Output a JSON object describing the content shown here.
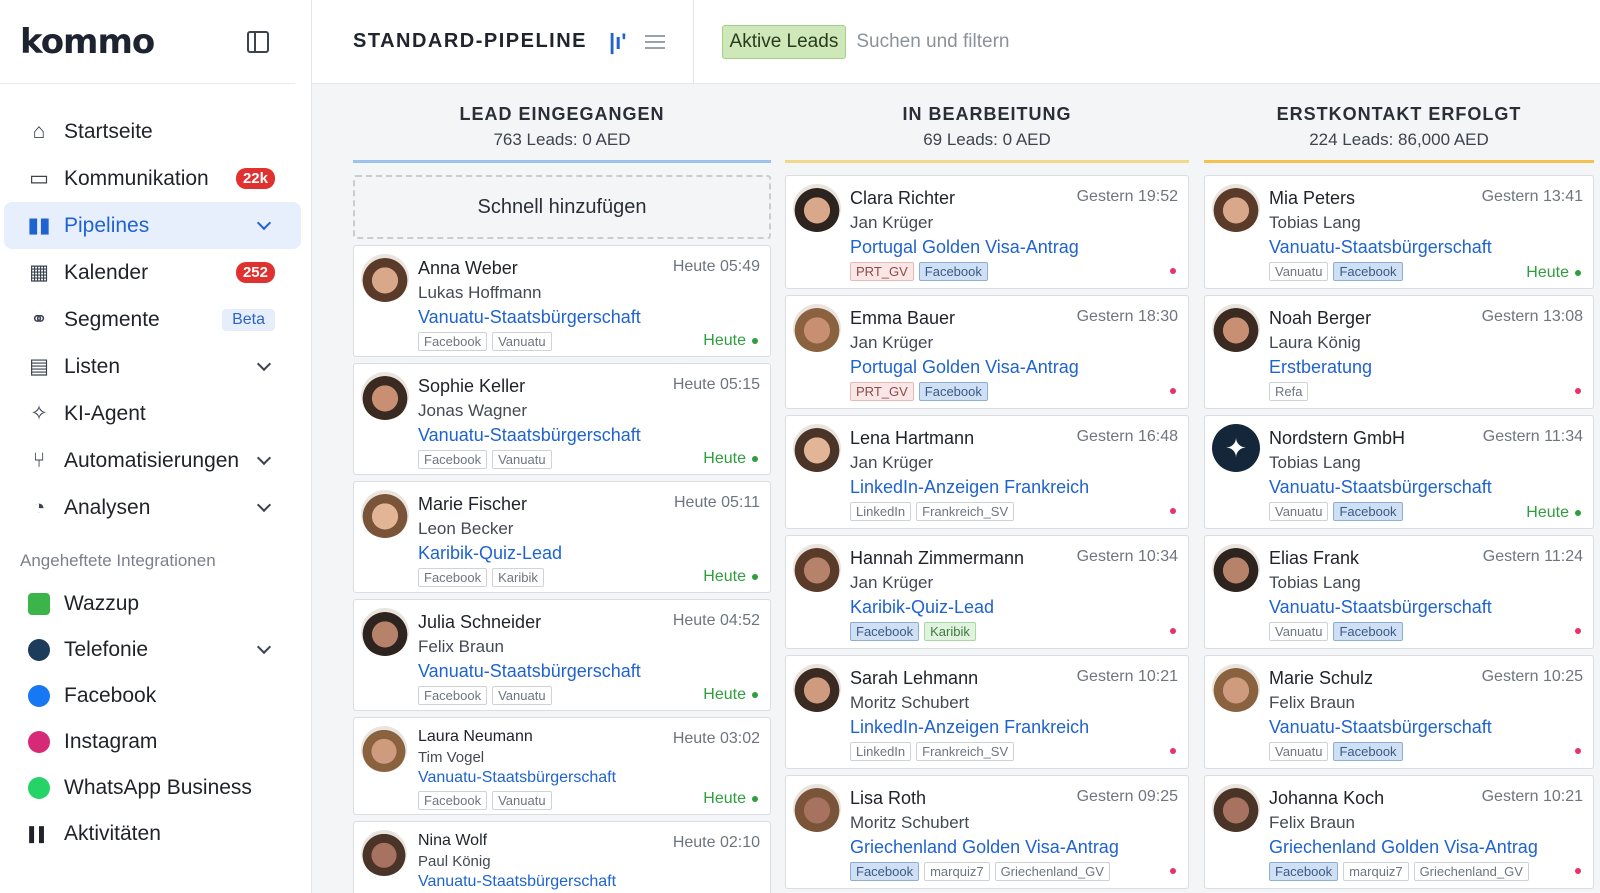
{
  "brand": {
    "logo": "kommo"
  },
  "sidebar": {
    "items": [
      {
        "label": "Startseite",
        "icon": "home-icon"
      },
      {
        "label": "Kommunikation",
        "icon": "chat-icon",
        "badge": "22k"
      },
      {
        "label": "Pipelines",
        "icon": "pipeline-icon",
        "active": true
      },
      {
        "label": "Kalender",
        "icon": "calendar-icon",
        "badge": "252"
      },
      {
        "label": "Segmente",
        "icon": "segments-icon",
        "tag": "Beta"
      },
      {
        "label": "Listen",
        "icon": "list-icon"
      },
      {
        "label": "KI-Agent",
        "icon": "sparkle-icon"
      },
      {
        "label": "Automatisierungen",
        "icon": "automation-icon"
      },
      {
        "label": "Analysen",
        "icon": "analytics-icon"
      }
    ],
    "section_title": "Angeheftete Integrationen",
    "integrations": [
      {
        "label": "Wazzup",
        "icon": "wazzup-icon",
        "color": "#3bb54a"
      },
      {
        "label": "Telefonie",
        "icon": "telephony-icon",
        "color": "#1d3b5a"
      },
      {
        "label": "Facebook",
        "icon": "facebook-icon",
        "color": "#1877f2"
      },
      {
        "label": "Instagram",
        "icon": "instagram-icon",
        "color": "#d62976"
      },
      {
        "label": "WhatsApp Business",
        "icon": "whatsapp-icon",
        "color": "#25d366"
      },
      {
        "label": "Aktivitäten",
        "icon": "activity-icon",
        "color": "#1f2329"
      }
    ]
  },
  "topbar": {
    "pipeline_title": "STANDARD-PIPELINE",
    "filter_label": "Aktive Leads",
    "search_placeholder": "Suchen und filtern"
  },
  "columns": [
    {
      "title": "LEAD EINGEGANGEN",
      "subtitle": "763 Leads: 0 AED",
      "line_color": "#9ec3ea",
      "quick_add": "Schnell hinzufügen",
      "cards": [
        {
          "name": "Anna Weber",
          "time": "Heute 05:49",
          "contact": "Lukas Hoffmann",
          "deal": "Vanuatu-Staatsbürgerschaft",
          "tags": [
            [
              "Facebook",
              ""
            ],
            [
              "Vanuatu",
              ""
            ]
          ],
          "due": "Heute"
        },
        {
          "name": "Sophie Keller",
          "time": "Heute 05:15",
          "contact": "Jonas Wagner",
          "deal": "Vanuatu-Staatsbürgerschaft",
          "tags": [
            [
              "Facebook",
              ""
            ],
            [
              "Vanuatu",
              ""
            ]
          ],
          "due": "Heute"
        },
        {
          "name": "Marie Fischer",
          "time": "Heute 05:11",
          "contact": "Leon Becker",
          "deal": "Karibik-Quiz-Lead",
          "tags": [
            [
              "Facebook",
              ""
            ],
            [
              "Karibik",
              ""
            ]
          ],
          "due": "Heute"
        },
        {
          "name": "Julia Schneider",
          "time": "Heute 04:52",
          "contact": "Felix Braun",
          "deal": "Vanuatu-Staatsbürgerschaft",
          "tags": [
            [
              "Facebook",
              ""
            ],
            [
              "Vanuatu",
              ""
            ]
          ],
          "due": "Heute"
        },
        {
          "name": "Laura Neumann",
          "time": "Heute 03:02",
          "contact": "Tim Vogel",
          "deal": "Vanuatu-Staatsbürgerschaft",
          "tags": [
            [
              "Facebook",
              ""
            ],
            [
              "Vanuatu",
              ""
            ]
          ],
          "due": "Heute"
        },
        {
          "name": "Nina Wolf",
          "time": "Heute 02:10",
          "contact": "Paul König",
          "deal": "Vanuatu-Staatsbürgerschaft",
          "tags": [],
          "due": ""
        }
      ]
    },
    {
      "title": "IN BEARBEITUNG",
      "subtitle": "69 Leads: 0 AED",
      "line_color": "#f2d98a",
      "cards": [
        {
          "name": "Clara Richter",
          "time": "Gestern 19:52",
          "contact": "Jan Krüger",
          "deal": "Portugal Golden Visa-Antrag",
          "tags": [
            [
              "PRT_GV",
              "red"
            ],
            [
              "Facebook",
              "blue"
            ]
          ],
          "due": ""
        },
        {
          "name": "Emma Bauer",
          "time": "Gestern 18:30",
          "contact": "Jan Krüger",
          "deal": "Portugal Golden Visa-Antrag",
          "tags": [
            [
              "PRT_GV",
              "red"
            ],
            [
              "Facebook",
              "blue"
            ]
          ],
          "due": ""
        },
        {
          "name": "Lena Hartmann",
          "time": "Gestern 16:48",
          "contact": "Jan Krüger",
          "deal": "LinkedIn-Anzeigen Frankreich",
          "tags": [
            [
              "LinkedIn",
              ""
            ],
            [
              "Frankreich_SV",
              ""
            ]
          ],
          "due": ""
        },
        {
          "name": "Hannah Zimmermann",
          "time": "Gestern 10:34",
          "contact": "Jan Krüger",
          "deal": "Karibik-Quiz-Lead",
          "tags": [
            [
              "Facebook",
              "blue"
            ],
            [
              "Karibik",
              "green"
            ]
          ],
          "due": ""
        },
        {
          "name": "Sarah Lehmann",
          "time": "Gestern 10:21",
          "contact": "Moritz Schubert",
          "deal": "LinkedIn-Anzeigen Frankreich",
          "tags": [
            [
              "LinkedIn",
              ""
            ],
            [
              "Frankreich_SV",
              ""
            ]
          ],
          "due": ""
        },
        {
          "name": "Lisa Roth",
          "time": "Gestern 09:25",
          "contact": "Moritz Schubert",
          "deal": "Griechenland Golden Visa-Antrag",
          "tags": [
            [
              "Facebook",
              "blue"
            ],
            [
              "marquiz7",
              ""
            ],
            [
              "Griechenland_GV",
              ""
            ]
          ],
          "due": ""
        }
      ]
    },
    {
      "title": "ERSTKONTAKT ERFOLGT",
      "subtitle": "224 Leads: 86,000 AED",
      "line_color": "#f2c14e",
      "cards": [
        {
          "name": "Mia Peters",
          "time": "Gestern 13:41",
          "contact": "Tobias Lang",
          "deal": "Vanuatu-Staatsbürgerschaft",
          "tags": [
            [
              "Vanuatu",
              ""
            ],
            [
              "Facebook",
              "blue"
            ]
          ],
          "due": "Heute"
        },
        {
          "name": "Noah Berger",
          "time": "Gestern 13:08",
          "contact": "Laura König",
          "deal": "Erstberatung",
          "tags": [
            [
              "Refa",
              ""
            ]
          ],
          "due": ""
        },
        {
          "name": "Nordstern GmbH",
          "time": "Gestern 11:34",
          "contact": "Tobias Lang",
          "deal": "Vanuatu-Staatsbürgerschaft",
          "tags": [
            [
              "Vanuatu",
              ""
            ],
            [
              "Facebook",
              "blue"
            ]
          ],
          "due": "Heute"
        },
        {
          "name": "Elias Frank",
          "time": "Gestern 11:24",
          "contact": "Tobias Lang",
          "deal": "Vanuatu-Staatsbürgerschaft",
          "tags": [
            [
              "Vanuatu",
              ""
            ],
            [
              "Facebook",
              "blue"
            ]
          ],
          "due": ""
        },
        {
          "name": "Marie Schulz",
          "time": "Gestern 10:25",
          "contact": "Felix Braun",
          "deal": "Vanuatu-Staatsbürgerschaft",
          "tags": [
            [
              "Vanuatu",
              ""
            ],
            [
              "Facebook",
              "blue"
            ]
          ],
          "due": ""
        },
        {
          "name": "Johanna Koch",
          "time": "Gestern 10:21",
          "contact": "Felix Braun",
          "deal": "Griechenland Golden Visa-Antrag",
          "tags": [
            [
              "Facebook",
              "blue"
            ],
            [
              "marquiz7",
              ""
            ],
            [
              "Griechenland_GV",
              ""
            ]
          ],
          "due": ""
        }
      ]
    }
  ]
}
